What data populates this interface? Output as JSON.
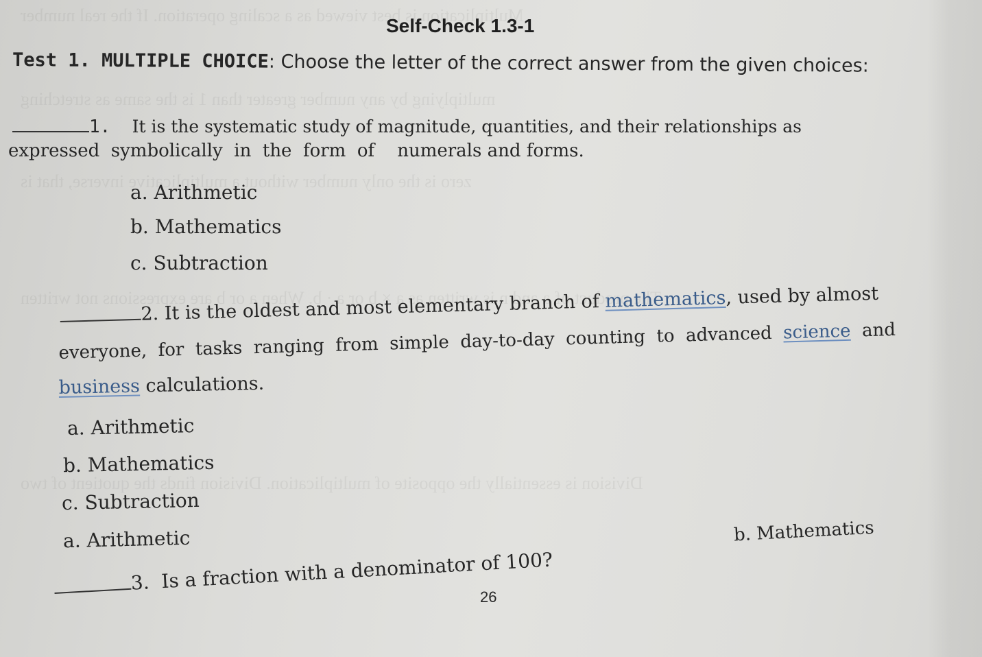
{
  "document": {
    "title": "Self-Check 1.3-1",
    "instructions": {
      "prefix": "Test 1. MULTIPLE CHOICE",
      "text": ": Choose the letter of the correct answer from the given choices:"
    },
    "questions": [
      {
        "number": "1.",
        "line1": "It is the systematic study of magnitude, quantities, and their relationships as",
        "line2": "expressed  symbolically  in  the  form  of    numerals and forms.",
        "choices": [
          "a. Arithmetic",
          "b. Mathematics",
          "c. Subtraction"
        ]
      },
      {
        "number": "2.",
        "line1_before_link": "It is the oldest and most elementary branch of ",
        "link1": "mathematics",
        "line1_after_link": ", used by almost",
        "line2_before_link": "everyone,  for  tasks  ranging  from  simple  day-to-day  counting  to  advanced  ",
        "link2": "science",
        "line2_after_link": "  and",
        "link3": "business",
        "line3_after_link": " calculations.",
        "choices": [
          "a. Arithmetic",
          "b. Mathematics",
          "c. Subtraction"
        ]
      },
      {
        "number": "3.",
        "text": "Is a fraction with a denominator of 100?",
        "choices": [
          "a. Arithmetic",
          "b. Mathematics"
        ]
      }
    ],
    "page_number": "26"
  }
}
